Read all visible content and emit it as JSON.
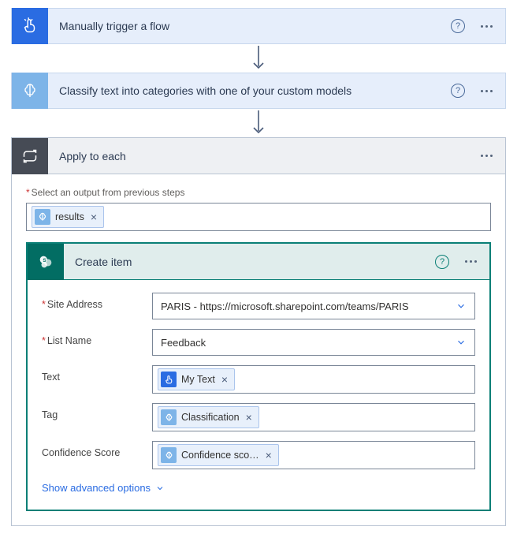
{
  "step1": {
    "title": "Manually trigger a flow"
  },
  "step2": {
    "title": "Classify text into categories with one of your custom models"
  },
  "apply": {
    "title": "Apply to each",
    "select_label": "Select an output from previous steps",
    "token": "results"
  },
  "create": {
    "title": "Create item",
    "fields": {
      "site": {
        "label": "Site Address",
        "value": "PARIS - https://microsoft.sharepoint.com/teams/PARIS"
      },
      "list": {
        "label": "List Name",
        "value": "Feedback"
      },
      "text": {
        "label": "Text",
        "token": "My Text"
      },
      "tag": {
        "label": "Tag",
        "token": "Classification"
      },
      "conf": {
        "label": "Confidence Score",
        "token": "Confidence sco…"
      }
    },
    "advanced": "Show advanced options"
  }
}
